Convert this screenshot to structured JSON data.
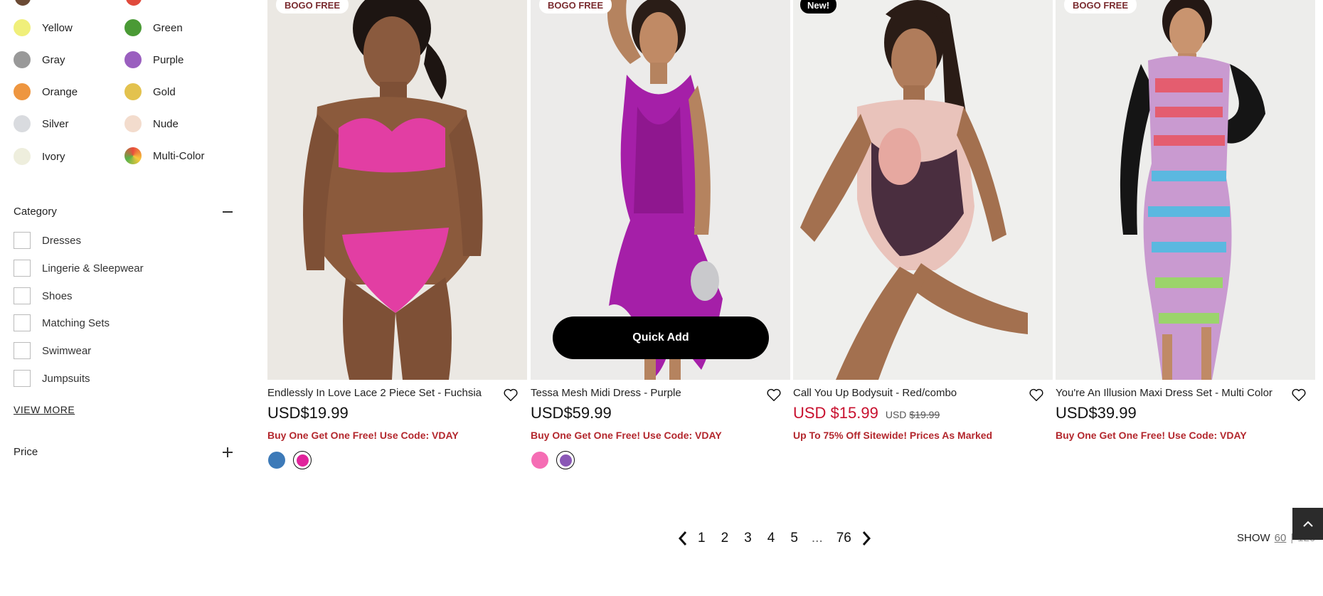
{
  "colors_filter": {
    "items": [
      {
        "label": "Yellow",
        "color": "#f0ef7a"
      },
      {
        "label": "Green",
        "color": "#4a9a35"
      },
      {
        "label": "Gray",
        "color": "#999999"
      },
      {
        "label": "Purple",
        "color": "#9a5fbf"
      },
      {
        "label": "Orange",
        "color": "#ee9640"
      },
      {
        "label": "Gold",
        "color": "#e3c24e"
      },
      {
        "label": "Silver",
        "color": "#d9dbdf"
      },
      {
        "label": "Nude",
        "color": "#f3dccd"
      },
      {
        "label": "Ivory",
        "color": "#eeeedd"
      },
      {
        "label": "Multi-Color",
        "color": "multi"
      }
    ],
    "partial_top_colors": [
      "#6b4a34",
      "#e04a3c"
    ]
  },
  "category_filter": {
    "title": "Category",
    "items": [
      "Dresses",
      "Lingerie & Sleepwear",
      "Shoes",
      "Matching Sets",
      "Swimwear",
      "Jumpsuits"
    ],
    "view_more": "VIEW MORE"
  },
  "price_filter": {
    "title": "Price"
  },
  "products": [
    {
      "badge": "BOGO FREE",
      "title": "Endlessly In Love Lace 2 Piece Set - Fuchsia",
      "price": "USD$19.99",
      "promo": "Buy One Get One Free! Use Code: VDAY",
      "swatches": [
        "#3d7ab8",
        "#e0239b"
      ],
      "selected_swatch": 1,
      "garment_color": "#e23ea3"
    },
    {
      "badge": "BOGO FREE",
      "title": "Tessa Mesh Midi Dress - Purple",
      "price": "USD$59.99",
      "promo": "Buy One Get One Free! Use Code: VDAY",
      "quick_add": "Quick Add",
      "swatches": [
        "#f56db4",
        "#8a57b6"
      ],
      "selected_swatch": 1,
      "garment_color": "#a51fa8"
    },
    {
      "badge": "New!",
      "title": "Call You Up Bodysuit - Red/combo",
      "sale_price": "USD $15.99",
      "orig_currency": "USD",
      "orig_price": "$19.99",
      "promo": "Up To 75% Off Sitewide! Prices As Marked",
      "garment_color": "#e9b7b0"
    },
    {
      "badge": "BOGO FREE",
      "title": "You're An Illusion Maxi Dress Set - Multi Color",
      "price": "USD$39.99",
      "promo": "Buy One Get One Free! Use Code: VDAY",
      "garment_color": "#c99ad0"
    }
  ],
  "pagination": {
    "pages": [
      "1",
      "2",
      "3",
      "4",
      "5"
    ],
    "ellipsis": "...",
    "last": "76",
    "show_label": "SHOW",
    "show_selected": "60",
    "show_separator": "|",
    "show_alt": "120"
  }
}
